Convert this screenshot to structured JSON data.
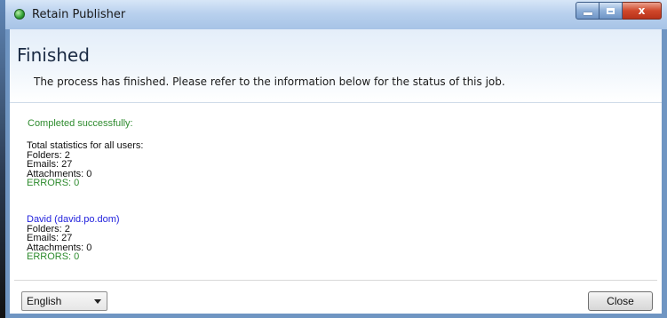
{
  "window": {
    "title": "Retain Publisher",
    "icon": "green-orb-icon",
    "caption_buttons": {
      "minimize": "minimize-icon",
      "maximize": "maximize-icon",
      "close_glyph": "x"
    }
  },
  "header": {
    "title": "Finished",
    "description": "The process has finished. Please refer to the information below for the status of this job."
  },
  "results": {
    "status": "Completed successfully:",
    "totals": {
      "heading": "Total statistics for all users:",
      "folders": "Folders: 2",
      "emails": "Emails: 27",
      "attachments": "Attachments: 0",
      "errors": "ERRORS: 0"
    },
    "users": [
      {
        "name": "David (david.po.dom)",
        "folders": "Folders: 2",
        "emails": "Emails: 27",
        "attachments": "Attachments: 0",
        "errors": "ERRORS: 0"
      }
    ]
  },
  "footer": {
    "language_selected": "English",
    "close_label": "Close"
  },
  "colors": {
    "success": "#2e8b2e",
    "user_name": "#2222dd",
    "title_bar": "#b9d1ee",
    "close_button": "#d0482b"
  }
}
